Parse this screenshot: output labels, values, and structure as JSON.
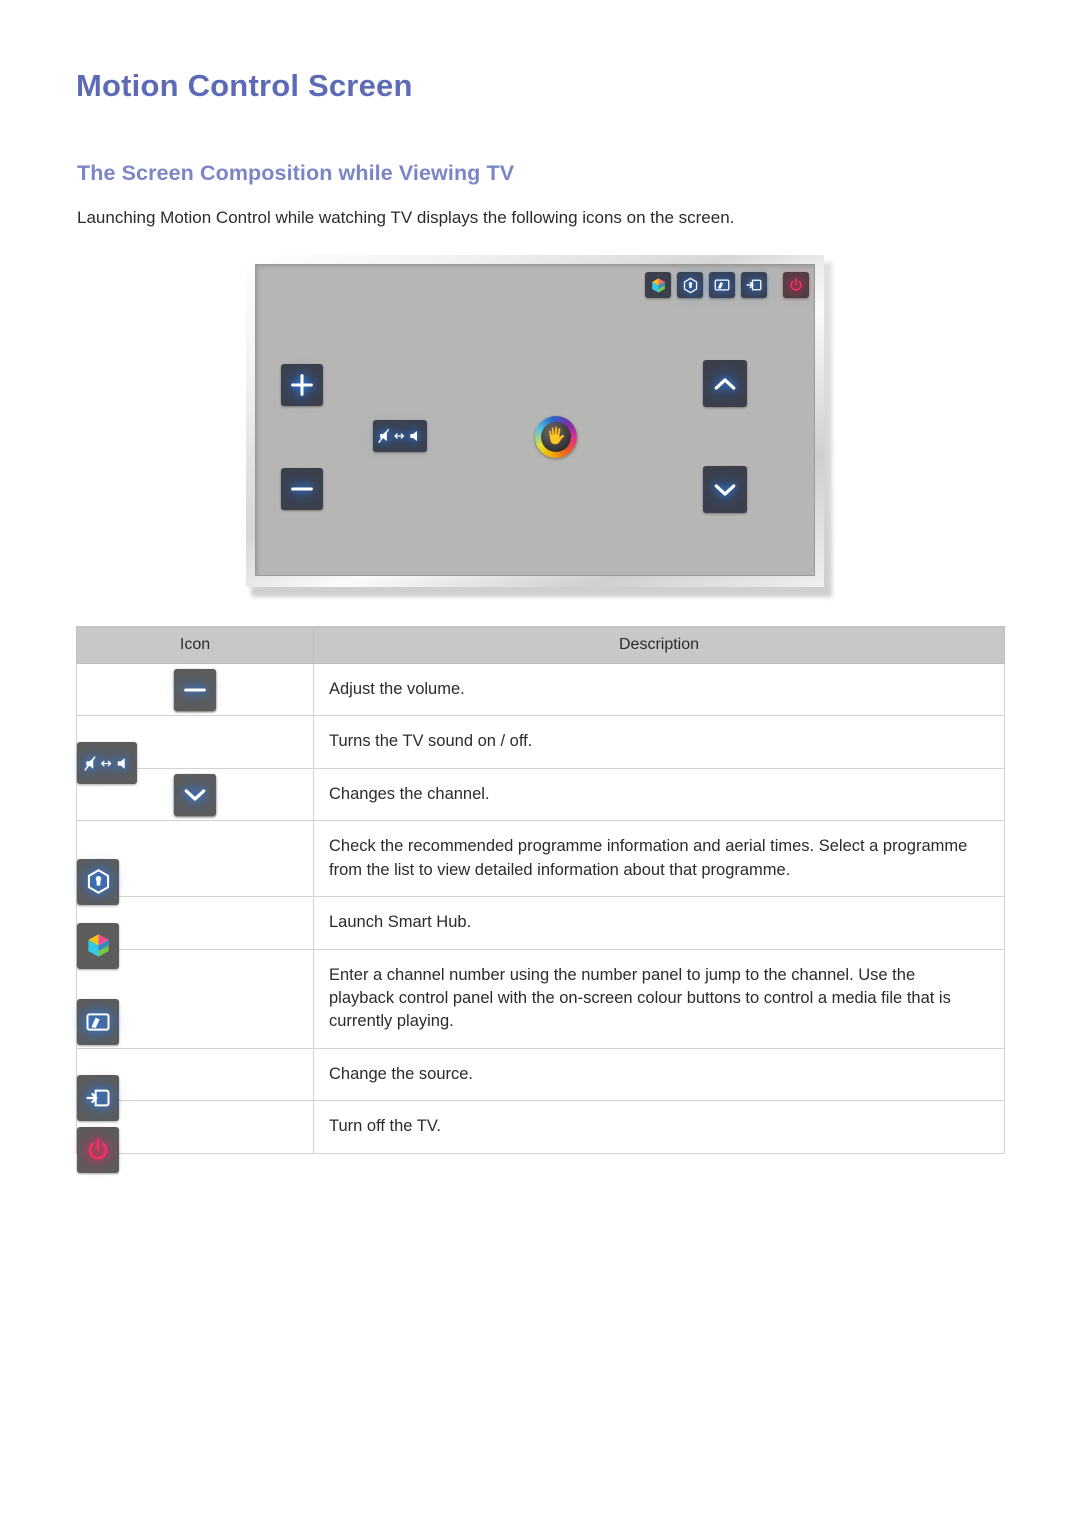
{
  "page": {
    "title": "Motion Control Screen",
    "section_heading": "The Screen Composition while Viewing TV",
    "intro": "Launching Motion Control while watching TV displays the following icons on the screen."
  },
  "colors": {
    "title": "#5d6ab5",
    "section_heading": "#7c86c6",
    "body_text": "#2b2b2b",
    "table_header_bg": "#c6c8ca",
    "table_border": "#d2d2d2",
    "tv_screen_bg": "#b6b6b4",
    "icon_tile_dark": "#3c3f4b",
    "icon_tile_gray": "#5c5c5c",
    "icon_glow_blue": "#2f86ff",
    "icon_glow_red": "#ff2d6a"
  },
  "tv_illustration": {
    "name": "motion-control-on-screen-overlay",
    "top_icons": [
      {
        "icon": "smart-hub-cube-icon",
        "label": "Smart Hub"
      },
      {
        "icon": "recommendation-hexagon-thumb-icon",
        "label": "Recommendations"
      },
      {
        "icon": "number-panel-screen-icon",
        "label": "Number / Playback Panel"
      },
      {
        "icon": "source-input-icon",
        "label": "Source"
      },
      {
        "icon": "power-icon",
        "label": "Power"
      }
    ],
    "controls": [
      {
        "icon": "volume-up-icon",
        "label": "Volume Up"
      },
      {
        "icon": "volume-down-icon",
        "label": "Volume Down"
      },
      {
        "icon": "mute-toggle-icon",
        "label": "Mute On / Off"
      },
      {
        "icon": "channel-up-icon",
        "label": "Channel Up"
      },
      {
        "icon": "channel-down-icon",
        "label": "Channel Down"
      },
      {
        "icon": "gesture-hand-cursor-icon",
        "label": "Motion Control Pointer"
      }
    ]
  },
  "table": {
    "headers": [
      "Icon",
      "Description"
    ],
    "rows": [
      {
        "icons": [
          "volume-up-icon",
          "volume-down-icon"
        ],
        "separator": "/",
        "description": "Adjust the volume."
      },
      {
        "icons": [
          "mute-toggle-icon"
        ],
        "separator": "",
        "description": "Turns the TV sound on / off."
      },
      {
        "icons": [
          "channel-up-icon",
          "channel-down-icon"
        ],
        "separator": "/",
        "description": "Changes the channel."
      },
      {
        "icons": [
          "recommendation-hexagon-thumb-icon"
        ],
        "separator": "",
        "description": "Check the recommended programme information and aerial times. Select a programme from the list to view detailed information about that programme."
      },
      {
        "icons": [
          "smart-hub-cube-icon"
        ],
        "separator": "",
        "description": "Launch Smart Hub."
      },
      {
        "icons": [
          "number-panel-screen-icon"
        ],
        "separator": "",
        "description": "Enter a channel number using the number panel to jump to the channel. Use the playback control panel with the on-screen colour buttons to control a media file that is currently playing."
      },
      {
        "icons": [
          "source-input-icon"
        ],
        "separator": "",
        "description": "Change the source."
      },
      {
        "icons": [
          "power-icon"
        ],
        "separator": "",
        "description": "Turn off the TV."
      }
    ]
  }
}
